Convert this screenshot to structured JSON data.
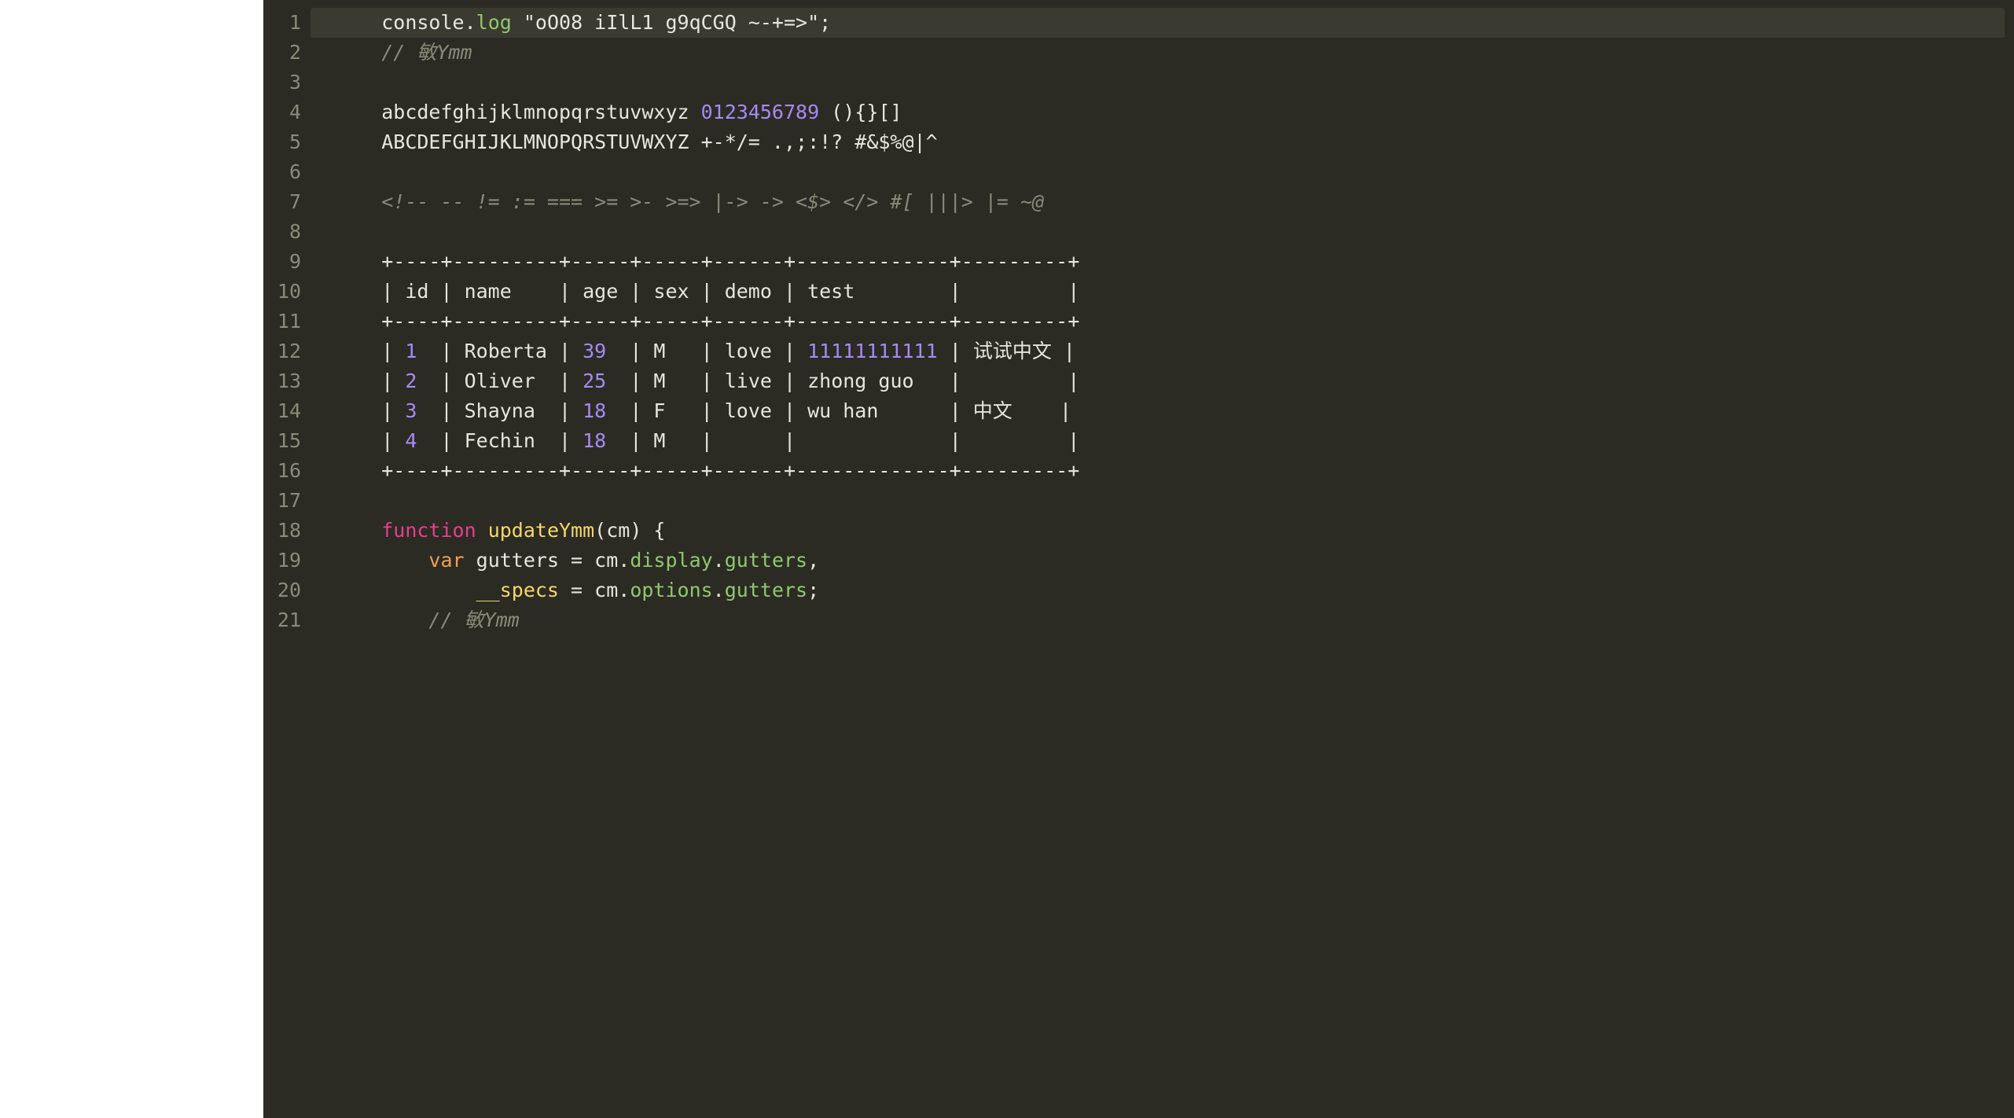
{
  "line_numbers": [
    "1",
    "2",
    "3",
    "4",
    "5",
    "6",
    "7",
    "8",
    "9",
    "10",
    "11",
    "12",
    "13",
    "14",
    "15",
    "16",
    "17",
    "18",
    "19",
    "20",
    "21"
  ],
  "code": {
    "l1": {
      "ind": "    ",
      "obj": "console",
      "dot": ".",
      "method": "log",
      "sp": " ",
      "str": "\"oO08 iIlL1 g9qCGQ ~-+=>\"",
      "semi": ";"
    },
    "l2": {
      "ind": "    ",
      "comment": "// 敏Ymm"
    },
    "l3": {
      "text": ""
    },
    "l4": {
      "ind": "    ",
      "plain1": "abcdefghijklmnopqrstuvwxyz ",
      "num": "0123456789",
      "plain2": " (){}[]"
    },
    "l5": {
      "ind": "    ",
      "text": "ABCDEFGHIJKLMNOPQRSTUVWXYZ +-*/= .,;:!? #&$%@|^"
    },
    "l6": {
      "text": ""
    },
    "l7": {
      "ind": "    ",
      "comment": "<!-- -- != := === >= >- >=> |-> -> <$> </> #[ |||> |= ~@"
    },
    "l8": {
      "text": ""
    },
    "l9": {
      "ind": "    ",
      "text": "+----+---------+-----+-----+------+-------------+---------+"
    },
    "l10": {
      "ind": "    ",
      "text": "| id | name    | age | sex | demo | test        |         |"
    },
    "l11": {
      "ind": "    ",
      "text": "+----+---------+-----+-----+------+-------------+---------+"
    },
    "l12": {
      "ind": "    ",
      "p1": "| ",
      "n1": "1",
      "p2": "  | Roberta | ",
      "n2": "39",
      "p3": "  | M   | love | ",
      "n3": "11111111111",
      "p4": " | 试试中文 |"
    },
    "l13": {
      "ind": "    ",
      "p1": "| ",
      "n1": "2",
      "p2": "  | Oliver  | ",
      "n2": "25",
      "p3": "  | M   | live | zhong guo   |         |"
    },
    "l14": {
      "ind": "    ",
      "p1": "| ",
      "n1": "3",
      "p2": "  | Shayna  | ",
      "n2": "18",
      "p3": "  | F   | love | wu han      | 中文    |"
    },
    "l15": {
      "ind": "    ",
      "p1": "| ",
      "n1": "4",
      "p2": "  | Fechin  | ",
      "n2": "18",
      "p3": "  | M   |      |             |         |"
    },
    "l16": {
      "ind": "    ",
      "text": "+----+---------+-----+-----+------+-------------+---------+"
    },
    "l17": {
      "text": ""
    },
    "l18": {
      "ind": "    ",
      "kw": "function",
      "sp1": " ",
      "fn": "updateYmm",
      "rest": "(cm) {"
    },
    "l19": {
      "ind": "        ",
      "kw": "var",
      "sp1": " ",
      "v1": "gutters",
      "eq": " = ",
      "obj1": "cm",
      "d1": ".",
      "p1": "display",
      "d2": ".",
      "p2": "gutters",
      "comma": ","
    },
    "l20": {
      "ind": "            ",
      "v1": "__specs",
      "eq": " = ",
      "obj1": "cm",
      "d1": ".",
      "p1": "options",
      "d2": ".",
      "p2": "gutters",
      "semi": ";"
    },
    "l21": {
      "ind": "        ",
      "comment": "// 敏Ymm"
    }
  }
}
